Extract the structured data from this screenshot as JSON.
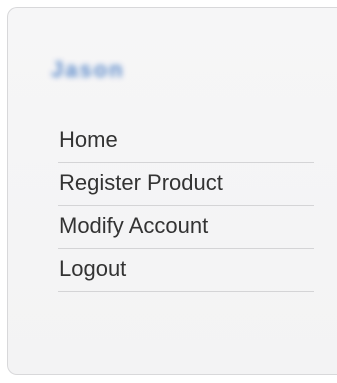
{
  "sidebar": {
    "user_name": "Jason",
    "menu": [
      {
        "label": "Home"
      },
      {
        "label": "Register Product"
      },
      {
        "label": "Modify Account"
      },
      {
        "label": "Logout"
      }
    ]
  },
  "colors": {
    "panel_bg": "#f5f5f6",
    "panel_border": "#d8d8da",
    "username": "#4c7fc5",
    "menu_text": "#333333",
    "divider": "#d4d4d6"
  }
}
